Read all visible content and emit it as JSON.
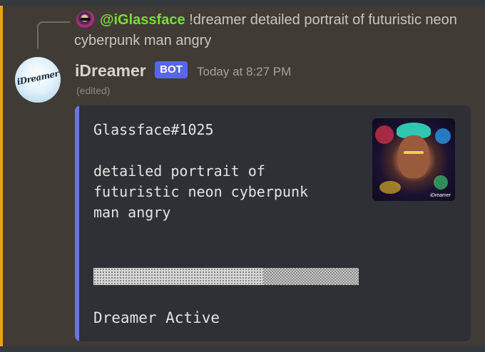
{
  "reply": {
    "mention": "@iGlassface",
    "content": " !dreamer detailed portrait of futuristic neon cyberpunk man angry"
  },
  "message": {
    "username": "iDreamer",
    "badge": "BOT",
    "timestamp": "Today at 8:27 PM",
    "edited_label": "(edited)",
    "avatar_logo_text": "iDreamer"
  },
  "embed": {
    "description": "Glassface#1025\n\ndetailed portrait of\nfuturistic neon cyberpunk\nman angry",
    "progress_fraction": 0.64,
    "status": "Dreamer Active",
    "thumbnail_watermark": "iDreamer",
    "accent_color": "#6b77d8"
  },
  "colors": {
    "mention": "#7ddc38",
    "bot_badge": "#5865f2",
    "highlight_bar": "#e8a21a"
  }
}
